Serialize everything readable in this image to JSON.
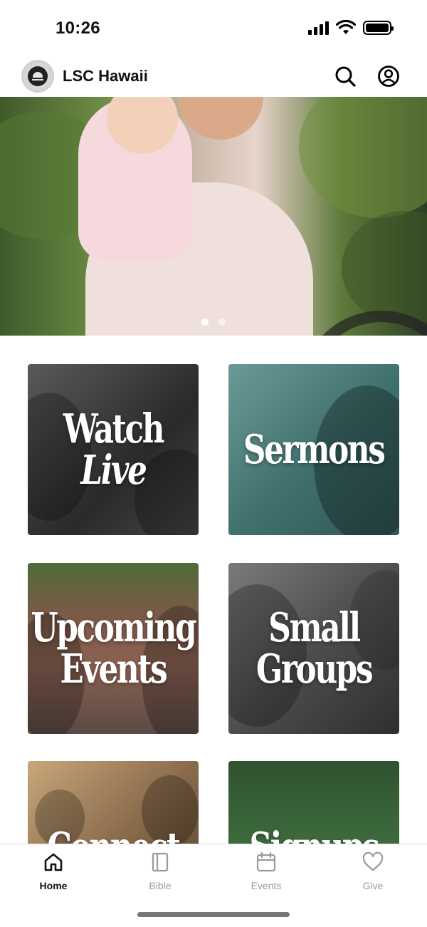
{
  "status_bar": {
    "time": "10:26"
  },
  "header": {
    "title": "LSC Hawaii"
  },
  "hero": {
    "slide_count": 2,
    "active_slide": 1
  },
  "cards": [
    {
      "line1": "Watch",
      "line2": "Live"
    },
    {
      "line1": "Sermons"
    },
    {
      "line1": "Upcoming",
      "line2": "Events"
    },
    {
      "line1": "Small",
      "line2": "Groups"
    },
    {
      "line1": "Connect"
    },
    {
      "line1": "Signups"
    }
  ],
  "tabs": [
    {
      "label": "Home",
      "icon": "home-icon",
      "active": true
    },
    {
      "label": "Bible",
      "icon": "book-icon",
      "active": false
    },
    {
      "label": "Events",
      "icon": "calendar-icon",
      "active": false
    },
    {
      "label": "Give",
      "icon": "heart-icon",
      "active": false
    }
  ],
  "colors": {
    "active_tab": "#111111",
    "inactive_tab": "#9a9a9a",
    "sermons_card": "#3e6f6c",
    "signups_card": "#2f5330"
  }
}
